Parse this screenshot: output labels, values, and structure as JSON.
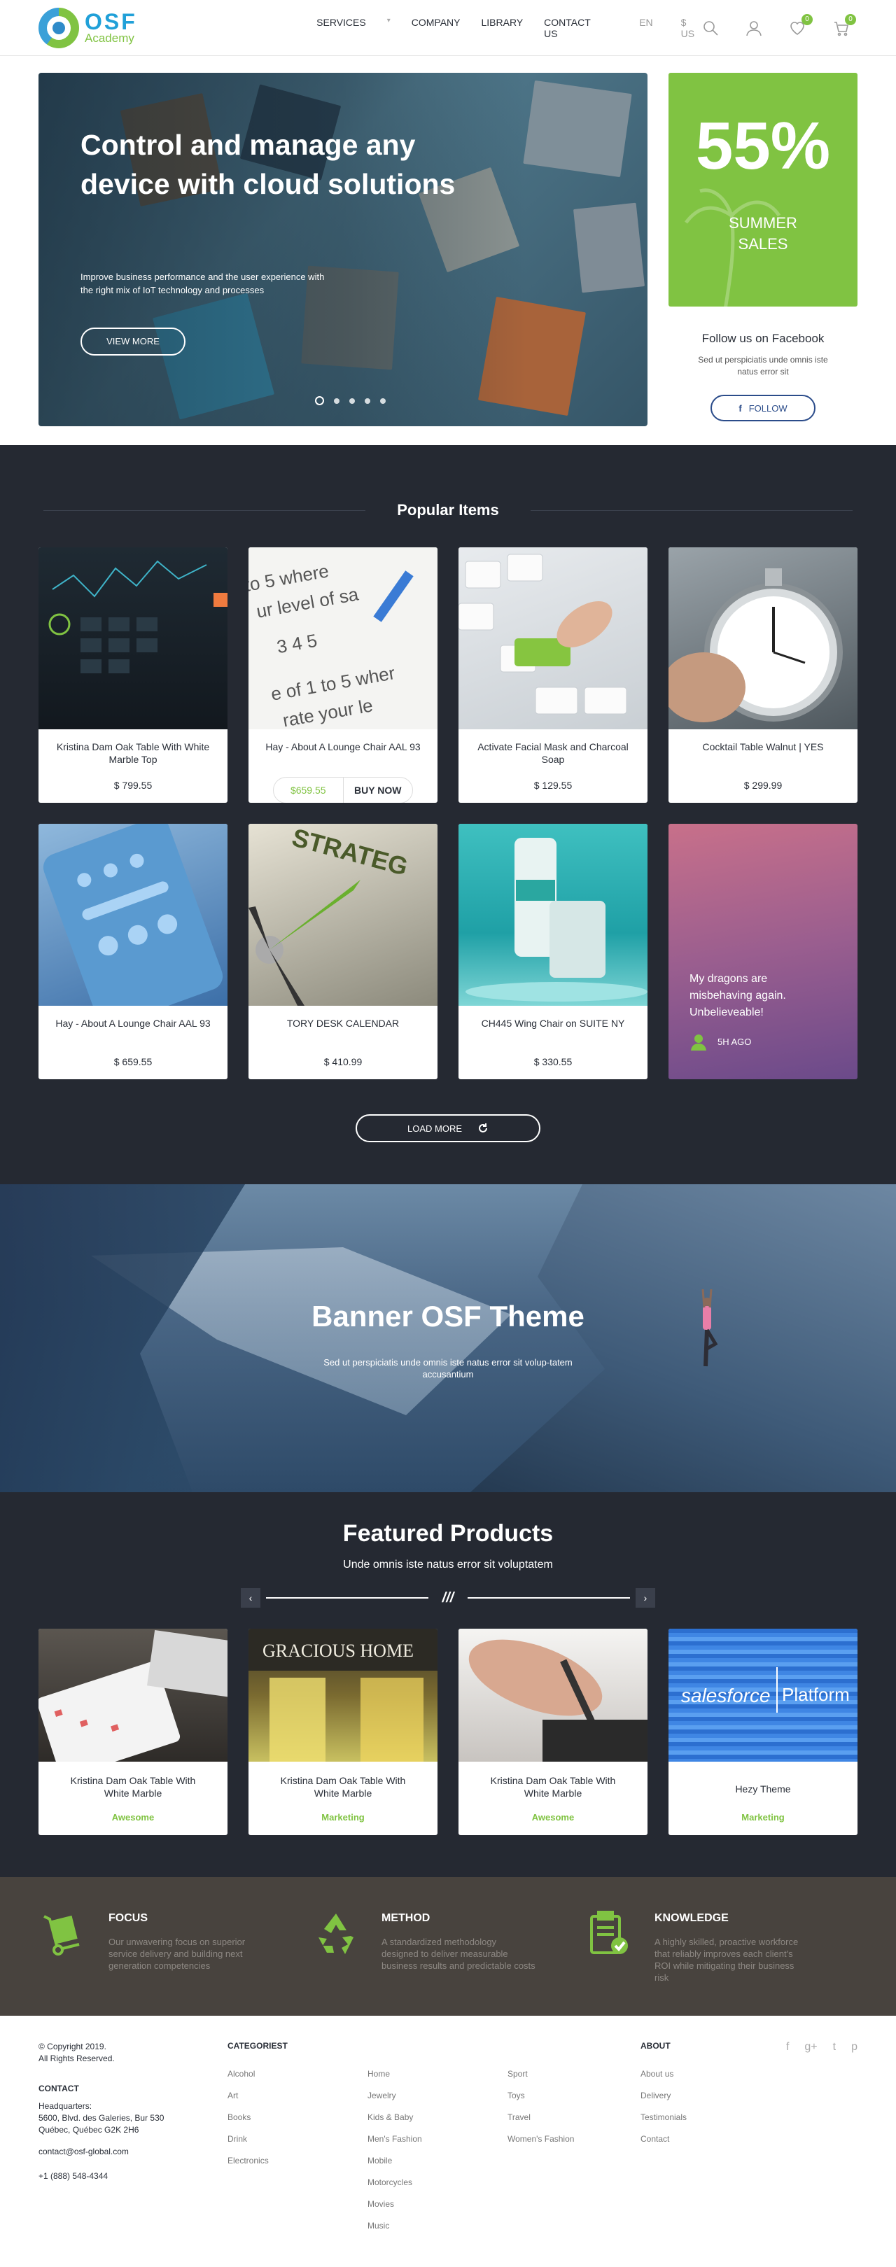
{
  "brand": {
    "name": "OSF",
    "sub": "Academy"
  },
  "nav": {
    "items": [
      "SERVICES",
      "COMPANY",
      "LIBRARY",
      "CONTACT US"
    ],
    "separator": "▾",
    "language": "EN",
    "currency": "$ US",
    "wishlist_count": "0",
    "cart_count": "0"
  },
  "hero": {
    "title": "Control and manage any device with cloud solutions",
    "text": "Improve business performance and the user experience with the right mix of IoT technology and processes",
    "button": "VIEW MORE"
  },
  "promo": {
    "percent": "55%",
    "line1": "SUMMER",
    "line2": "SALES"
  },
  "facebook": {
    "title": "Follow us on Facebook",
    "text": "Sed ut perspiciatis unde omnis iste natus error sit",
    "button": "FOLLOW"
  },
  "popular": {
    "title": "Popular Items",
    "items": [
      {
        "name": "Kristina Dam Oak Table With White Marble Top",
        "price": "$ 799.55"
      },
      {
        "name": "Hay - About A Lounge Chair AAL 93",
        "price": "$659.55",
        "buy": "BUY NOW"
      },
      {
        "name": "Activate Facial Mask and Charcoal Soap",
        "price": "$ 129.55"
      },
      {
        "name": "Cocktail Table Walnut | YES",
        "price": "$ 299.99"
      },
      {
        "name": "Hay - About A Lounge Chair AAL 93",
        "price": "$ 659.55"
      },
      {
        "name": "TORY DESK CALENDAR",
        "price": "$ 410.99"
      },
      {
        "name": "CH445 Wing Chair on SUITE NY",
        "price": "$ 330.55"
      }
    ],
    "testimonial": {
      "quote": "My dragons are misbehaving again. Unbelieveable!",
      "time": "5H AGO"
    },
    "load_more": "LOAD MORE"
  },
  "banner": {
    "title": "Banner OSF Theme",
    "text": "Sed ut perspiciatis unde omnis iste natus error sit volup-tatem accusantium"
  },
  "featured": {
    "title": "Featured Products",
    "subtitle": "Unde omnis iste natus error sit voluptatem",
    "prev": "‹",
    "next": "›",
    "mark": "///",
    "items": [
      {
        "name": "Kristina Dam Oak Table With White Marble",
        "tag": "Awesome"
      },
      {
        "name": "Kristina Dam Oak Table With White Marble",
        "tag": "Marketing"
      },
      {
        "name": "Kristina Dam Oak Table With White Marble",
        "tag": "Awesome"
      },
      {
        "name": "Hezy Theme",
        "tag": "Marketing"
      }
    ],
    "salesforce": {
      "brand": "salesforce",
      "platform": "Platform"
    },
    "shop_sign": "GRACIOUS HOME"
  },
  "features": [
    {
      "title": "FOCUS",
      "text": "Our unwavering focus on superior service delivery and building next generation competencies"
    },
    {
      "title": "METHOD",
      "text": "A standardized methodology designed to deliver measurable business results and predictable costs"
    },
    {
      "title": "KNOWLEDGE",
      "text": "A highly skilled, proactive workforce that reliably improves each client's ROI while mitigating their business risk"
    }
  ],
  "footer": {
    "copyright": "© Copyright 2019.",
    "rights": "All Rights Reserved.",
    "contact_label": "CONTACT",
    "hq": "Headquarters:",
    "addr1": "5600, Blvd. des Galeries, Bur 530",
    "addr2": "Québec, Québec G2K 2H6",
    "email": "contact@osf-global.com",
    "phone": "+1 (888) 548-4344",
    "categories_title": "CATEGORIEST",
    "categories": [
      [
        "Alcohol",
        "Art",
        "Books",
        "Drink",
        "Electronics"
      ],
      [
        "Home",
        "Jewelry",
        "Kids & Baby",
        "Men's Fashion",
        "Mobile",
        "Motorcycles",
        "Movies",
        "Music"
      ],
      [
        "Sport",
        "Toys",
        "Travel",
        "Women's Fashion"
      ]
    ],
    "about_title": "ABOUT",
    "about": [
      "About us",
      "Delivery",
      "Testimonials",
      "Contact"
    ],
    "social": [
      "f",
      "g+",
      "t",
      "p"
    ]
  },
  "colors": {
    "accent": "#80c342",
    "dark": "#252932",
    "brand_blue": "#20a0d8",
    "features_bg": "#48433e"
  }
}
